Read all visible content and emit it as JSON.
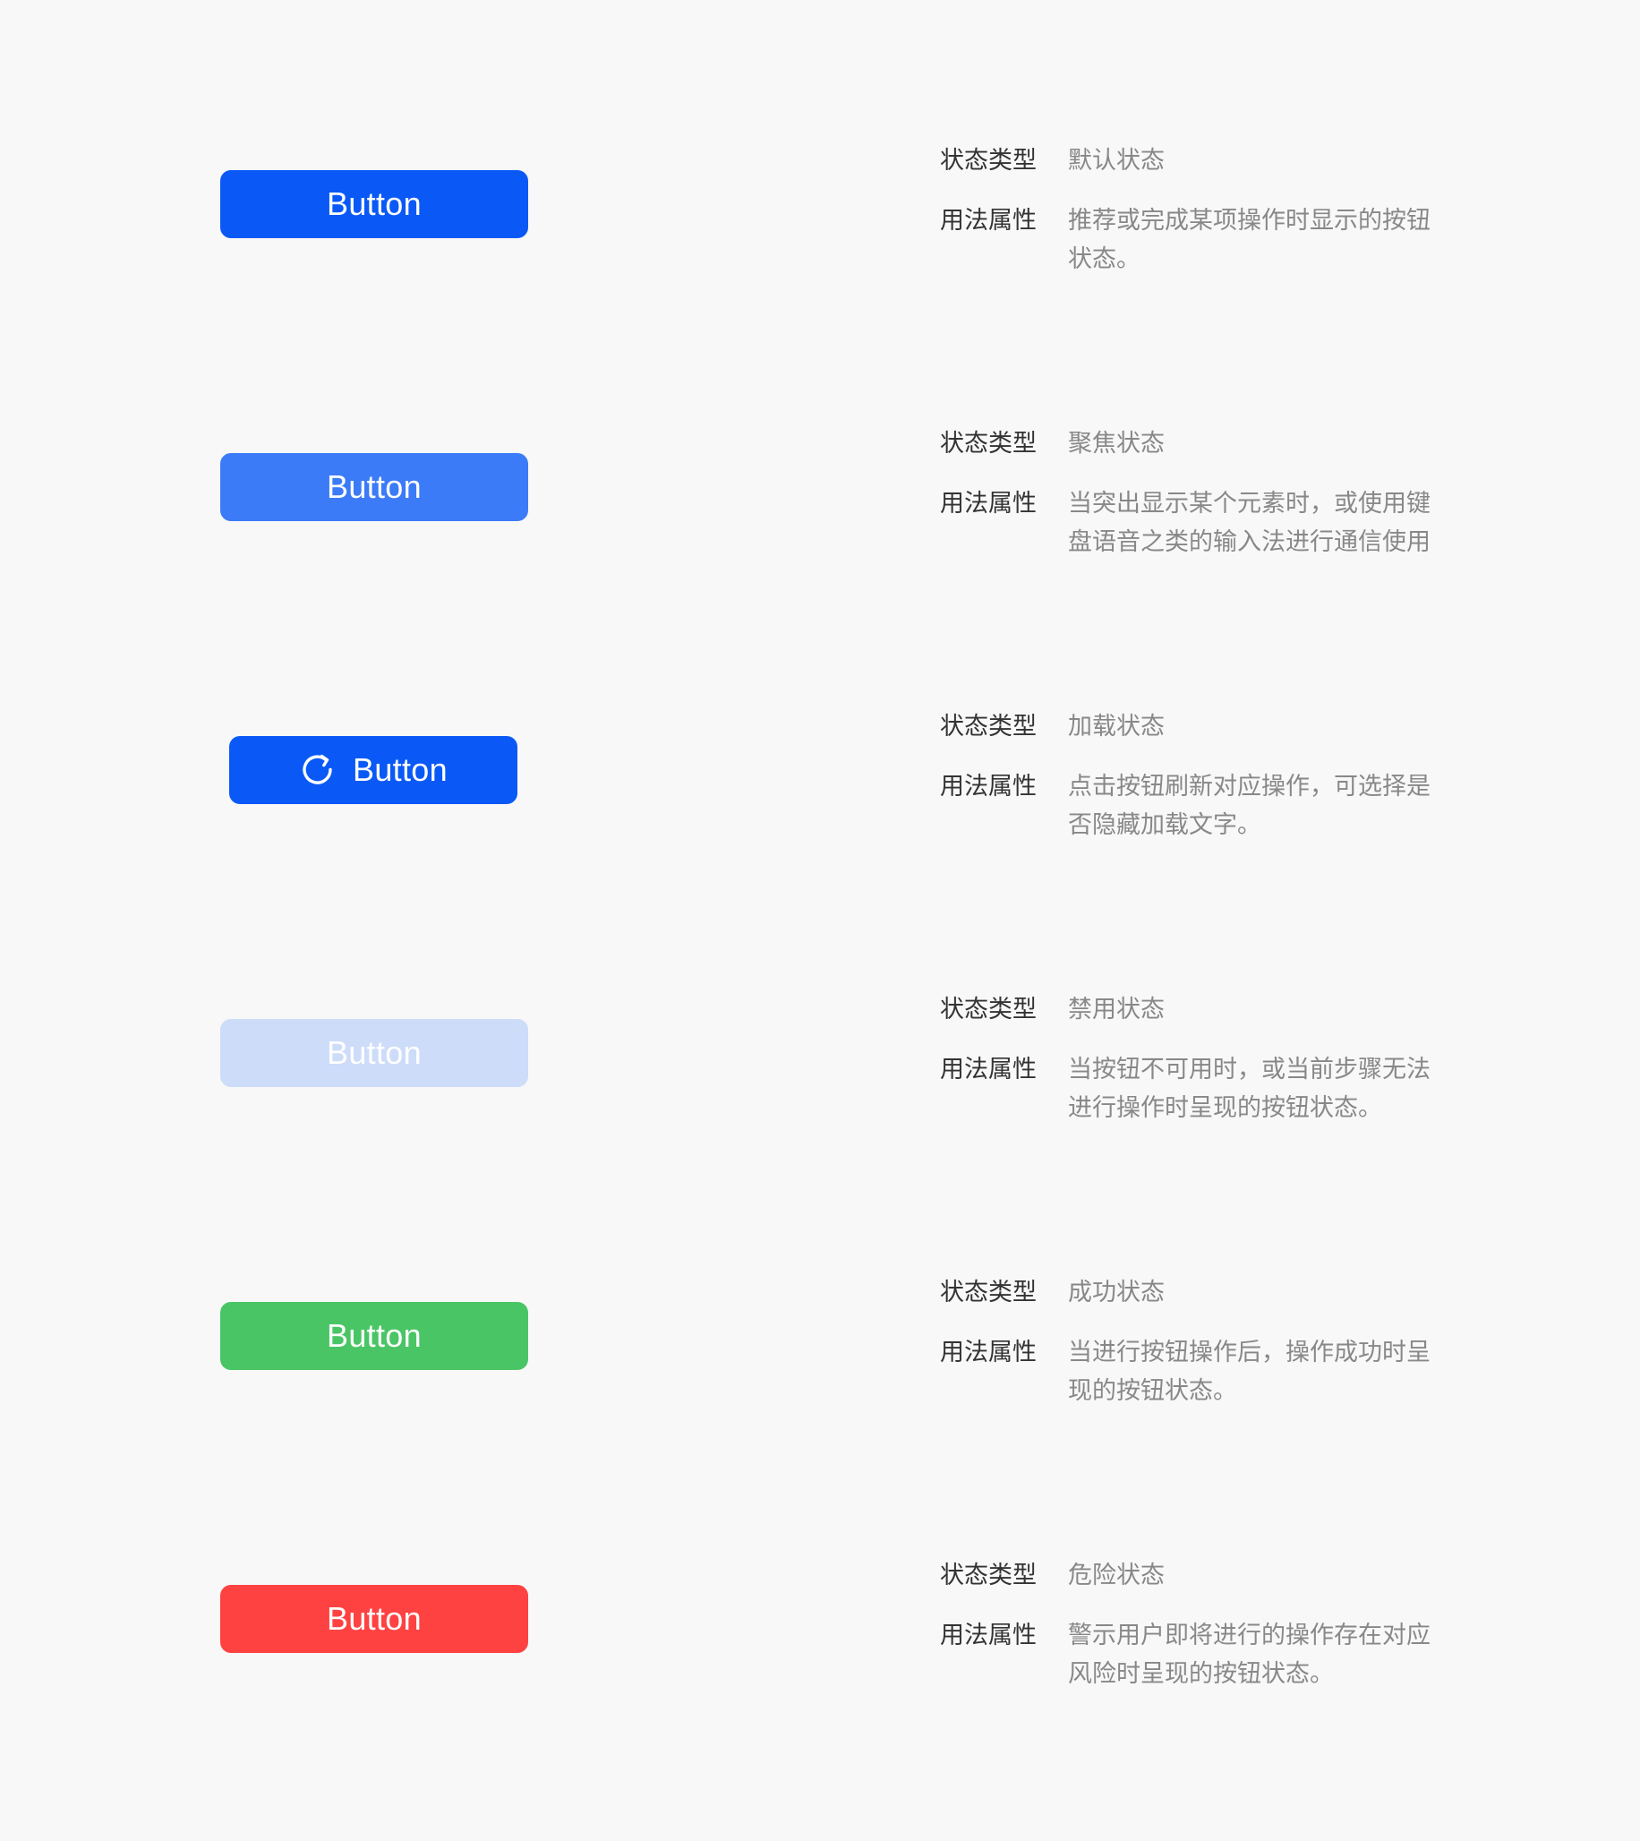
{
  "colors": {
    "background": "#f8f8f8",
    "key_text": "#333333",
    "value_text": "#888888",
    "button_text": "#ffffff"
  },
  "labels": {
    "type_key": "状态类型",
    "usage_key": "用法属性"
  },
  "states": [
    {
      "button_label": "Button",
      "button_color": "#0a59f7",
      "button_text_color": "#ffffff",
      "type_value": "默认状态",
      "usage_value": "推荐或完成某项操作时显示的按钮状态。"
    },
    {
      "button_label": "Button",
      "button_color": "#3b7bf8",
      "button_text_color": "#ffffff",
      "type_value": "聚焦状态",
      "usage_value": "当突出显示某个元素时，或使用键盘语音之类的输入法进行通信使用"
    },
    {
      "button_label": "Button",
      "button_color": "#0a59f7",
      "button_text_color": "#ffffff",
      "icon": "refresh-icon",
      "type_value": "加载状态",
      "usage_value": "点击按钮刷新对应操作，可选择是否隐藏加载文字。"
    },
    {
      "button_label": "Button",
      "button_color": "#cddcf9",
      "button_text_color": "#ffffff",
      "type_value": "禁用状态",
      "usage_value": "当按钮不可用时，或当前步骤无法进行操作时呈现的按钮状态。"
    },
    {
      "button_label": "Button",
      "button_color": "#4ac565",
      "button_text_color": "#ffffff",
      "type_value": "成功状态",
      "usage_value": "当进行按钮操作后，操作成功时呈现的按钮状态。"
    },
    {
      "button_label": "Button",
      "button_color": "#fe4242",
      "button_text_color": "#ffffff",
      "type_value": "危险状态",
      "usage_value": "警示用户即将进行的操作存在对应风险时呈现的按钮状态。"
    }
  ]
}
